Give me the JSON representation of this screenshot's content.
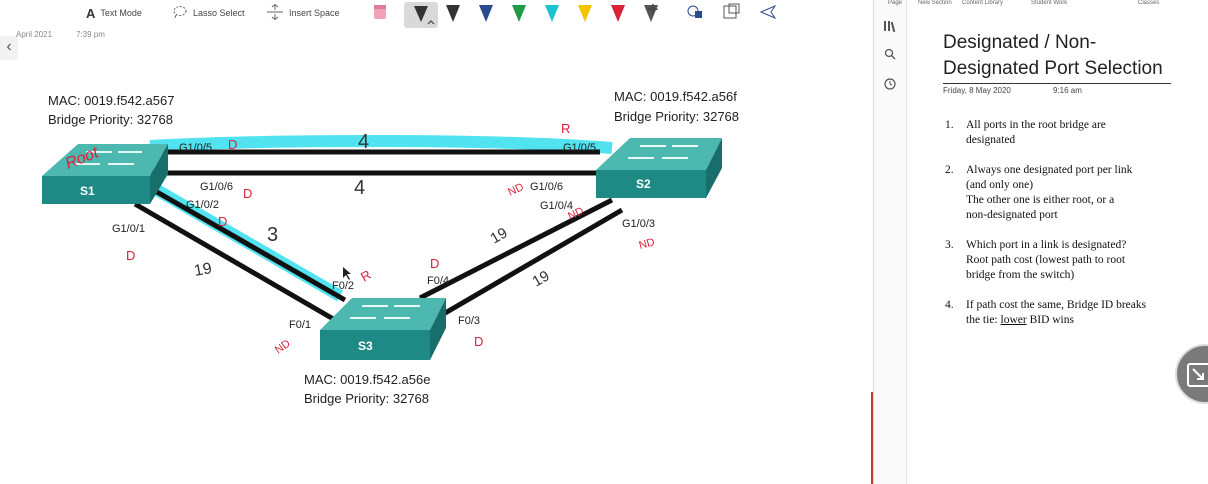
{
  "toolbar": {
    "text_mode": "Text Mode",
    "lasso_select": "Lasso Select",
    "insert_space": "Insert Space",
    "text_mode_icon": "A",
    "pens": [
      "#333333",
      "#333333",
      "#2a4b8d",
      "#1f9a45",
      "#19c3d2",
      "#f2c500",
      "#d8233b",
      "#555555"
    ],
    "plus_icon": "+"
  },
  "page_meta": {
    "date": "April 2021",
    "time": "7:39 pm"
  },
  "diagram": {
    "s1": {
      "name": "S1",
      "mac": "MAC: 0019.f542.a567",
      "priority": "Bridge Priority: 32768"
    },
    "s2": {
      "name": "S2",
      "mac": "MAC: 0019.f542.a56f",
      "priority": "Bridge Priority: 32768"
    },
    "s3": {
      "name": "S3",
      "mac": "MAC: 0019.f542.a56e",
      "priority": "Bridge Priority: 32768"
    },
    "ports": {
      "s1_g105": "G1/0/5",
      "s1_g106": "G1/0/6",
      "s1_g102": "G1/0/2",
      "s1_g101": "G1/0/1",
      "s2_g105": "G1/0/5",
      "s2_g106": "G1/0/6",
      "s2_g104": "G1/0/4",
      "s2_g103": "G1/0/3",
      "s3_f02": "F0/2",
      "s3_f04": "F0/4",
      "s3_f01": "F0/1",
      "s3_f03": "F0/3"
    },
    "handwriting": {
      "root": "Root",
      "cost_top": "4",
      "cost_mid": "4",
      "cost_s1s3": "3",
      "cost_19_left": "19",
      "cost_19_right1": "19",
      "cost_19_right2": "19",
      "d": "D",
      "r": "R",
      "nd": "ND"
    }
  },
  "right_panel": {
    "top_tabs": [
      "Page",
      "New Section",
      "Content Library",
      "Student Work",
      "Classes"
    ],
    "title": "Designated / Non-Designated Port Selection",
    "date": "Friday, 8 May 2020",
    "time": "9:16 am",
    "notes": [
      {
        "num": "1.",
        "lines": [
          "All ports in the root bridge are",
          "designated"
        ]
      },
      {
        "num": "2.",
        "lines": [
          "Always one designated port per link",
          "(and only one)",
          "The other one is either root, or a",
          "non-designated port"
        ]
      },
      {
        "num": "3.",
        "lines": [
          "Which port in a link is designated?",
          "Root path cost (lowest path to root",
          "bridge from the switch)"
        ]
      },
      {
        "num": "4.",
        "lines": [
          "If path cost the same, Bridge ID breaks"
        ],
        "tail_prefix": "the tie: ",
        "tail_underlined": "lower",
        "tail_suffix": " BID wins"
      }
    ]
  }
}
